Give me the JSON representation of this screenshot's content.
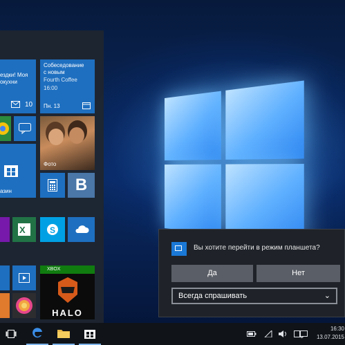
{
  "start_menu": {
    "tiles": {
      "mail_text": "ездки! Моя\nокухни",
      "mail_count": "10",
      "calendar_line1": "Собеседование",
      "calendar_line2": "с новым",
      "calendar_line3": "Fourth Coffee",
      "calendar_time": "16:00",
      "calendar_date": "Пн. 13",
      "photos_label": "Фото",
      "store_label": "азин",
      "vk_letter": "B",
      "xbox_label": "XBOX",
      "halo_label": "HALO"
    }
  },
  "dialog": {
    "question": "Вы хотите перейти в режим планшета?",
    "yes": "Да",
    "no": "Нет",
    "select_value": "Всегда спрашивать"
  },
  "taskbar": {
    "time": "16:30",
    "date": "13.07.2015"
  },
  "colors": {
    "accent": "#1e6fc0",
    "dialog_bg": "#1f2329",
    "taskbar_bg": "#101419"
  }
}
